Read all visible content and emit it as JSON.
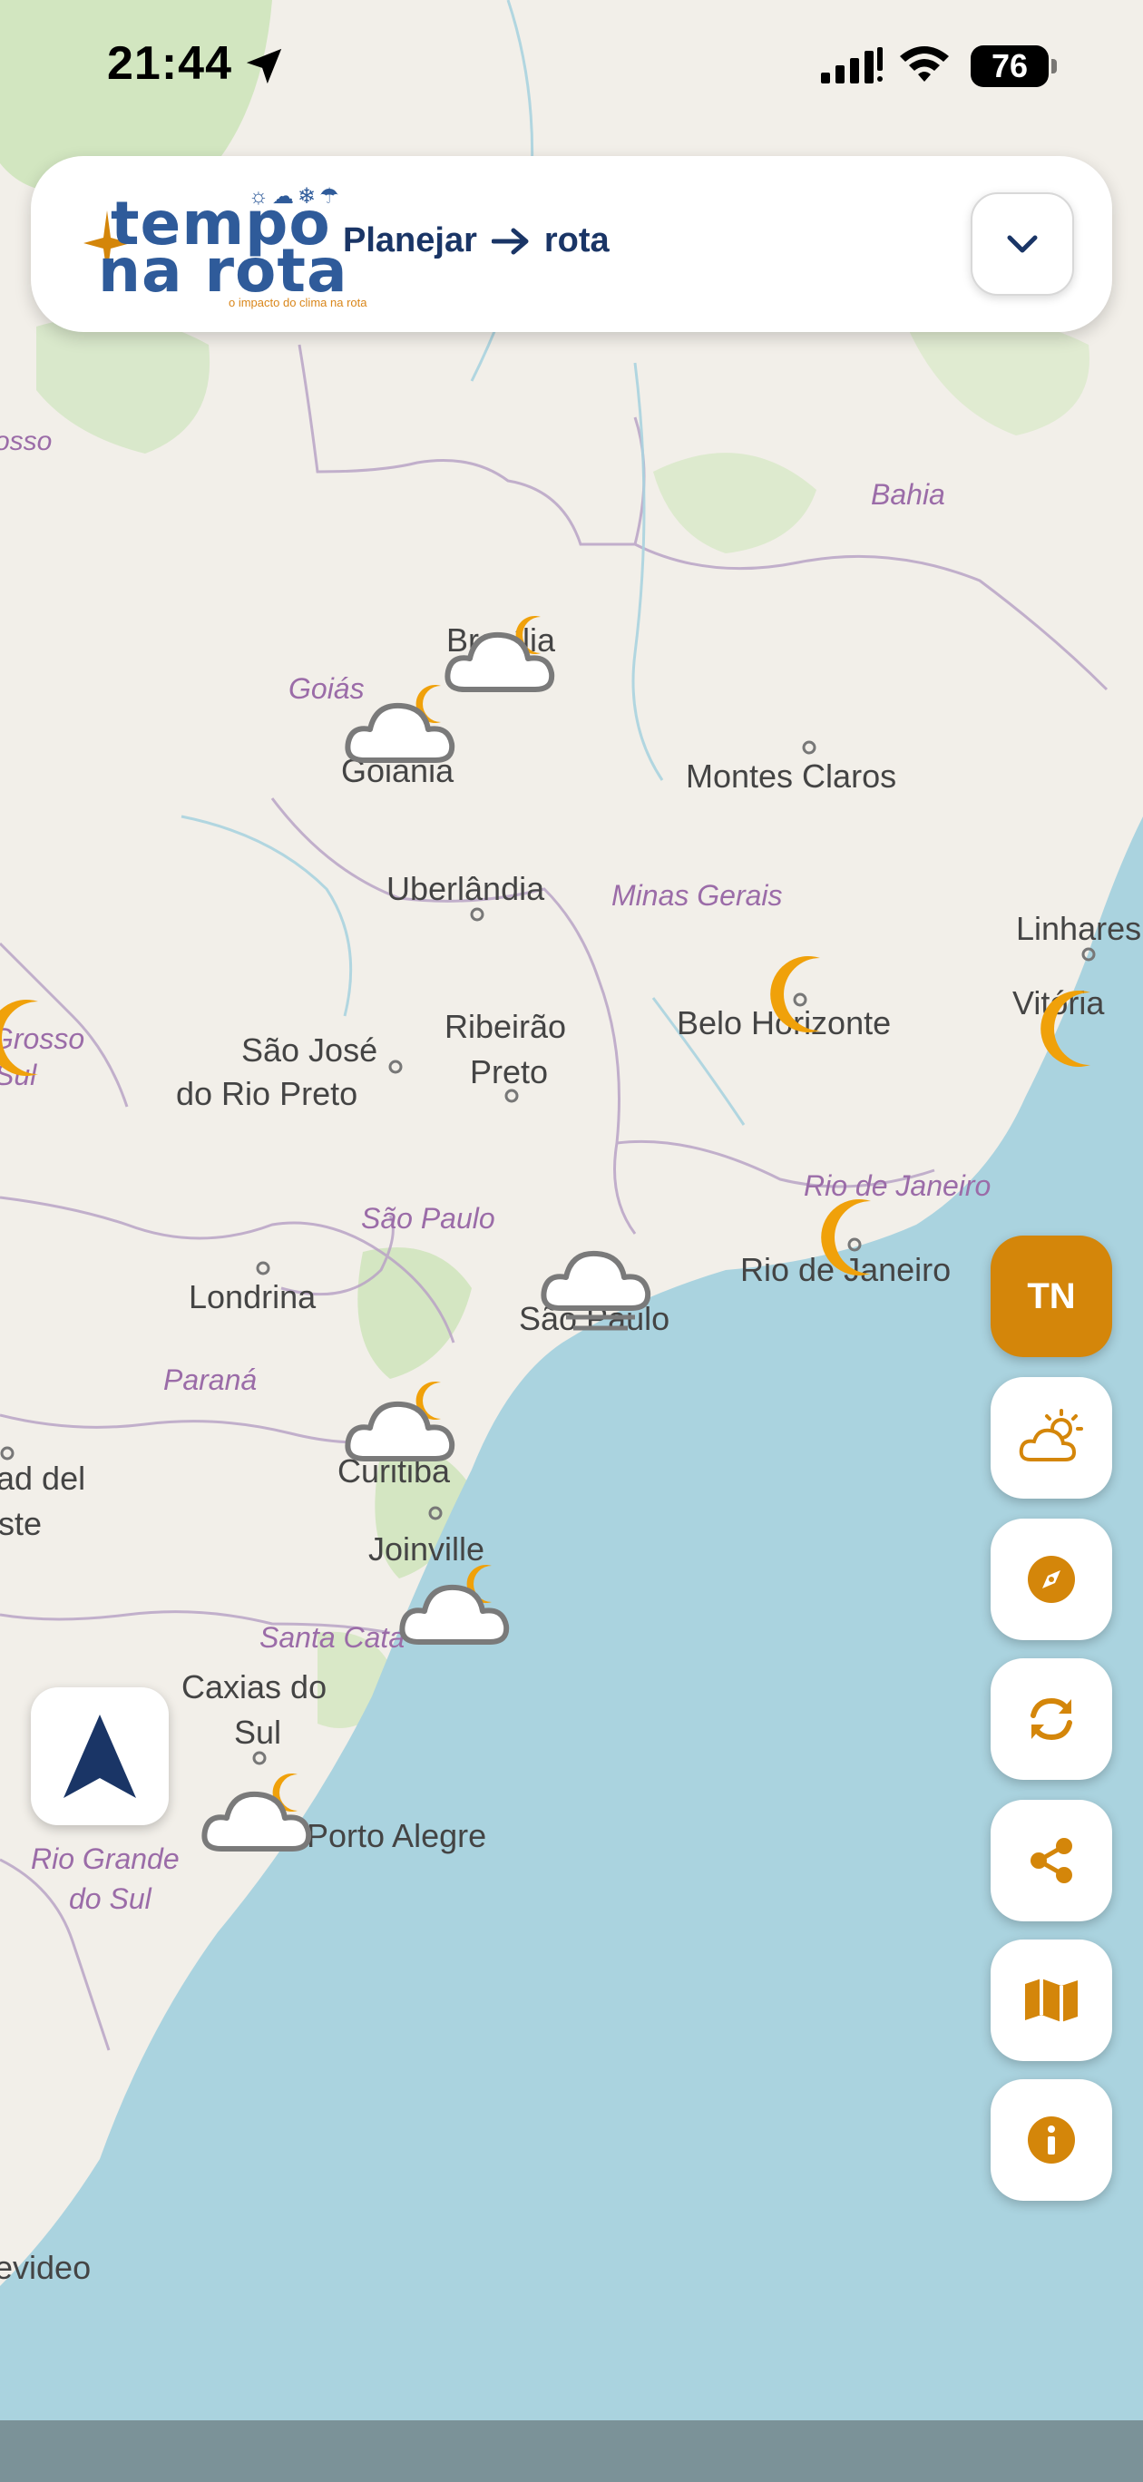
{
  "status_bar": {
    "time": "21:44",
    "battery": "76"
  },
  "header": {
    "logo_line1": "tempo",
    "logo_line2": "na rota",
    "logo_tagline": "o impacto do clima na rota",
    "route_from": "Planejar",
    "route_to": "rota"
  },
  "rail": {
    "tn_label": "TN"
  },
  "map": {
    "labels": {
      "bahia": "Bahia",
      "goias": "Goiás",
      "brasilia": "Brasília",
      "goiania": "Goiânia",
      "montes_claros": "Montes Claros",
      "uberlandia": "Uberlândia",
      "minas_gerais": "Minas Gerais",
      "linhares": "Linhares",
      "vitoria": "Vitória",
      "mato_grosso": "Grosso",
      "mato_grosso_sul": "Sul",
      "sao_jose": "São José",
      "do_rio_preto": "do Rio Preto",
      "ribeirao": "Ribeirão",
      "preto": "Preto",
      "belo_horizonte": "Belo Horizonte",
      "rio_de_janeiro_state": "Rio de Janeiro",
      "rio_de_janeiro_city": "Rio de Janeiro",
      "sao_paulo_state": "São Paulo",
      "sao_paulo_city": "São Paulo",
      "londrina": "Londrina",
      "parana": "Paraná",
      "curitiba": "Curitiba",
      "joinville": "Joinville",
      "ciudad_del": "ad del",
      "este": "ste",
      "santa_catarina": "Santa Cata",
      "caxias": "Caxias do",
      "caxias_sul": "Sul",
      "porto_alegre": "Porto Alegre",
      "rio_grande": "Rio Grande",
      "do_sul": "do Sul",
      "montevideo": "evideo",
      "osso": "osso"
    },
    "weather_markers": [
      {
        "city": "Brasília",
        "icon": "cloud-moon-icon"
      },
      {
        "city": "Goiânia",
        "icon": "cloud-moon-icon"
      },
      {
        "city": "Belo Horizonte",
        "icon": "moon-icon"
      },
      {
        "city": "Vitória",
        "icon": "moon-icon"
      },
      {
        "city": "Mato Grosso do Sul",
        "icon": "moon-icon"
      },
      {
        "city": "Rio de Janeiro",
        "icon": "moon-icon"
      },
      {
        "city": "São Paulo",
        "icon": "fog-cloud-icon"
      },
      {
        "city": "Curitiba",
        "icon": "cloud-moon-icon"
      },
      {
        "city": "Joinville",
        "icon": "cloud-moon-icon"
      },
      {
        "city": "Porto Alegre",
        "icon": "cloud-moon-icon"
      }
    ]
  },
  "colors": {
    "accent": "#d4860a",
    "brand_blue": "#1a3566",
    "sea": "#aad3df",
    "land": "#f2efe9"
  }
}
